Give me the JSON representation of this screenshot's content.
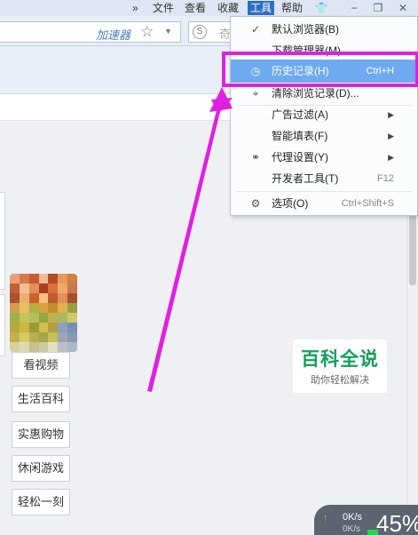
{
  "menubar": {
    "chevron": "»",
    "items": [
      "文件",
      "查看",
      "收藏",
      "工具",
      "帮助"
    ],
    "active_index": 3,
    "window_controls": [
      "shirt-icon",
      "minimize-icon",
      "restore-icon",
      "close-icon"
    ]
  },
  "address_bar": {
    "accelerator_label": "加速器",
    "star": "☆",
    "dropdown": "▼",
    "search_text": "奇"
  },
  "tools_menu": {
    "items": [
      {
        "icon": "check-icon",
        "glyph": "✓",
        "label": "默认浏览器(B)",
        "shortcut": ""
      },
      {
        "icon": "",
        "glyph": "",
        "label": "下载管理器(M)",
        "shortcut": ""
      },
      {
        "icon": "clock-icon",
        "glyph": "◷",
        "label": "历史记录(H)",
        "shortcut": "Ctrl+H",
        "highlighted": true
      },
      {
        "icon": "broom-icon",
        "glyph": "⌖",
        "label": "清除浏览记录(D)...",
        "shortcut": ""
      },
      {
        "icon": "",
        "glyph": "",
        "label": "广告过滤(A)",
        "submenu": true
      },
      {
        "icon": "",
        "glyph": "",
        "label": "智能填表(F)",
        "submenu": true
      },
      {
        "icon": "link-icon",
        "glyph": "⚭",
        "label": "代理设置(Y)",
        "submenu": true
      },
      {
        "icon": "",
        "glyph": "",
        "label": "开发者工具(T)",
        "shortcut": "F12"
      },
      {
        "icon": "gear-icon",
        "glyph": "⚙",
        "label": "选项(O)",
        "shortcut": "Ctrl+Shift+S"
      }
    ]
  },
  "sidebar_nav": [
    "看视频",
    "生活百科",
    "实惠购物",
    "休闲游戏",
    "轻松一刻"
  ],
  "watermark": {
    "title": "百科全说",
    "subtitle": "助你轻松解决"
  },
  "speed_widget": {
    "up_arrow": "↑",
    "speed": "0K/s",
    "down_speed": "0K/s",
    "percent": "45%"
  },
  "colors": {
    "highlight": "#6eaaf0",
    "annotation": "#e020e0",
    "menubar_active": "#2f6fc0"
  }
}
